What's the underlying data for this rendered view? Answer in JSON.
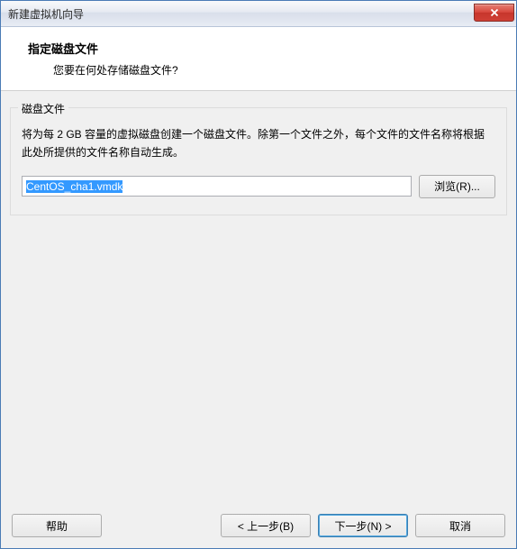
{
  "window": {
    "title": "新建虚拟机向导"
  },
  "header": {
    "title": "指定磁盘文件",
    "subtitle": "您要在何处存储磁盘文件?"
  },
  "group": {
    "label": "磁盘文件",
    "description": "将为每 2 GB 容量的虚拟磁盘创建一个磁盘文件。除第一个文件之外，每个文件的文件名称将根据此处所提供的文件名称自动生成。"
  },
  "file": {
    "value": "CentOS_cha1.vmdk",
    "browse_label": "浏览(R)..."
  },
  "footer": {
    "help_label": "帮助",
    "back_label": "< 上一步(B)",
    "next_label": "下一步(N) >",
    "cancel_label": "取消"
  }
}
